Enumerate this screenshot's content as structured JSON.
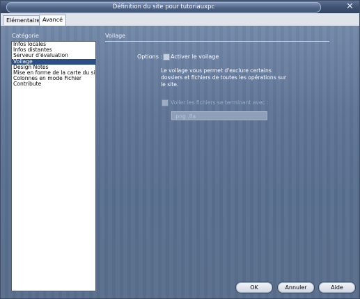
{
  "window": {
    "title": "Définition du site pour tutoriauxpc",
    "close_icon": "close-icon"
  },
  "tabs": [
    {
      "label": "Elémentaire",
      "active": false
    },
    {
      "label": "Avancé",
      "active": true
    }
  ],
  "category": {
    "label": "Catégorie",
    "items": [
      "Infos locales",
      "Infos distantes",
      "Serveur d'évaluation",
      "Voilage",
      "Design Notes",
      "Mise en forme de la carte du site",
      "Colonnes en mode Fichier",
      "Contribute"
    ],
    "selected_index": 3
  },
  "section": {
    "title": "Voilage",
    "options_label": "Options :",
    "activate_label": "Activer le voilage",
    "activate_checked": false,
    "description": "Le voilage vous permet d'exclure certains dossiers et fichiers de toutes les opérations sur le site.",
    "mask_label": "Voiler les fichiers se terminant avec :",
    "mask_checked": false,
    "mask_input_value": ".png .fla"
  },
  "buttons": {
    "ok": "OK",
    "cancel": "Annuler",
    "help": "Aide"
  },
  "colors": {
    "title_bar": "#3f5273",
    "selection": "#2b4f86",
    "panel": "#617698"
  }
}
